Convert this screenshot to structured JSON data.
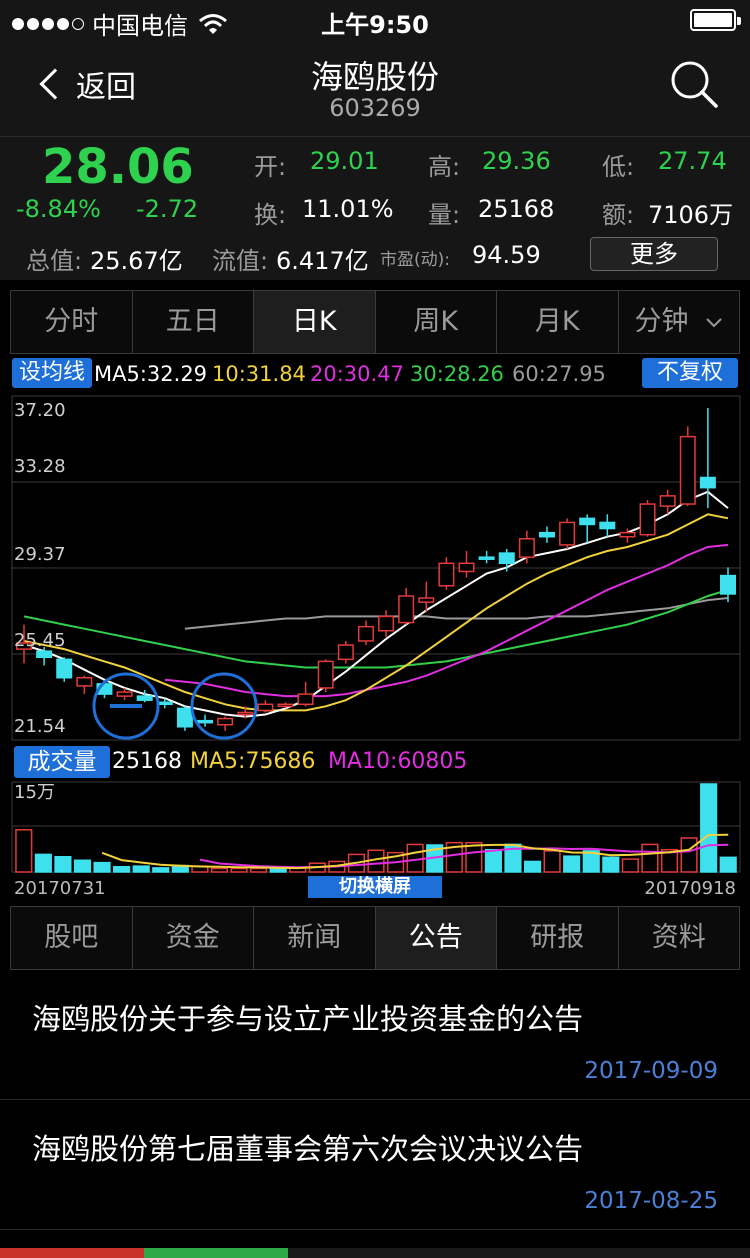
{
  "status_bar": {
    "carrier": "中国电信",
    "time": "上午9:50",
    "signal_bars": 4
  },
  "nav": {
    "back_label": "返回",
    "title": "海鸥股份",
    "code": "603269"
  },
  "quote": {
    "price": "28.06",
    "change_pct": "-8.84%",
    "change": "-2.72",
    "open_label": "开:",
    "open": "29.01",
    "high_label": "高:",
    "high": "29.36",
    "low_label": "低:",
    "low": "27.74",
    "turnover_label": "换:",
    "turnover": "11.01%",
    "volume_label": "量:",
    "volume": "25168",
    "amount_label": "额:",
    "amount": "7106万",
    "total_cap_label": "总值:",
    "total_cap": "25.67亿",
    "float_cap_label": "流值:",
    "float_cap": "6.417亿",
    "pe_label": "市盈(动):",
    "pe": "94.59",
    "more_label": "更多"
  },
  "chart_tabs": [
    {
      "label": "分时"
    },
    {
      "label": "五日"
    },
    {
      "label": "日K"
    },
    {
      "label": "周K"
    },
    {
      "label": "月K"
    },
    {
      "label": "分钟"
    }
  ],
  "active_chart_tab": "日K",
  "ma_bar": {
    "set_ma_label": "设均线",
    "ma5": "MA5:32.29",
    "ma10": "10:31.84",
    "ma20": "20:30.47",
    "ma30": "30:28.26",
    "ma60": "60:27.95",
    "adjust_label": "不复权"
  },
  "volume_bar": {
    "label": "成交量",
    "value": "25168",
    "ma5": "MA5:75686",
    "ma10": "MA10:60805",
    "scale_label": "15万"
  },
  "dates": {
    "start": "20170731",
    "end": "20170918",
    "switch_label": "切换横屏"
  },
  "colors": {
    "up": "#e33b3b",
    "down": "#3fe0ee",
    "ma5": "#ffffff",
    "ma10": "#f2d23c",
    "ma20": "#e02ee0",
    "ma30": "#32d04a",
    "ma60": "#9a9a9a",
    "accent_blue": "#1e6fd8",
    "green_price": "#2fd24f"
  },
  "chart_data": {
    "type": "candlestick",
    "y_axis_labels": [
      "37.20",
      "33.28",
      "29.37",
      "25.45",
      "21.54"
    ],
    "ylim": [
      21.54,
      37.2
    ],
    "candles": [
      {
        "o": 25.4,
        "c": 25.7,
        "h": 26.6,
        "l": 24.7
      },
      {
        "o": 25.3,
        "c": 25.0,
        "h": 25.5,
        "l": 24.6
      },
      {
        "o": 24.9,
        "c": 24.0,
        "h": 25.0,
        "l": 23.8
      },
      {
        "o": 23.6,
        "c": 24.0,
        "h": 24.1,
        "l": 23.2
      },
      {
        "o": 23.7,
        "c": 23.2,
        "h": 23.9,
        "l": 23.0
      },
      {
        "o": 23.1,
        "c": 23.3,
        "h": 23.5,
        "l": 22.9
      },
      {
        "o": 23.1,
        "c": 22.9,
        "h": 23.4,
        "l": 22.8
      },
      {
        "o": 22.8,
        "c": 22.7,
        "h": 23.0,
        "l": 22.5
      },
      {
        "o": 22.5,
        "c": 21.6,
        "h": 22.6,
        "l": 21.4
      },
      {
        "o": 21.9,
        "c": 21.8,
        "h": 22.2,
        "l": 21.6
      },
      {
        "o": 21.7,
        "c": 22.0,
        "h": 22.1,
        "l": 21.4
      },
      {
        "o": 22.3,
        "c": 22.3,
        "h": 22.6,
        "l": 22.0
      },
      {
        "o": 22.4,
        "c": 22.7,
        "h": 22.9,
        "l": 22.3
      },
      {
        "o": 22.6,
        "c": 22.7,
        "h": 22.8,
        "l": 22.5
      },
      {
        "o": 22.7,
        "c": 23.2,
        "h": 23.8,
        "l": 22.6
      },
      {
        "o": 23.5,
        "c": 24.8,
        "h": 24.9,
        "l": 23.3
      },
      {
        "o": 24.9,
        "c": 25.6,
        "h": 25.8,
        "l": 24.7
      },
      {
        "o": 25.8,
        "c": 26.5,
        "h": 26.8,
        "l": 25.6
      },
      {
        "o": 26.3,
        "c": 27.0,
        "h": 27.3,
        "l": 26.0
      },
      {
        "o": 26.7,
        "c": 28.0,
        "h": 28.4,
        "l": 26.6
      },
      {
        "o": 27.7,
        "c": 27.9,
        "h": 28.7,
        "l": 27.2
      },
      {
        "o": 28.5,
        "c": 29.6,
        "h": 29.9,
        "l": 28.3
      },
      {
        "o": 29.2,
        "c": 29.6,
        "h": 30.2,
        "l": 28.9
      },
      {
        "o": 29.9,
        "c": 29.8,
        "h": 30.2,
        "l": 29.6
      },
      {
        "o": 30.1,
        "c": 29.6,
        "h": 30.3,
        "l": 29.2
      },
      {
        "o": 29.9,
        "c": 30.8,
        "h": 31.2,
        "l": 29.6
      },
      {
        "o": 31.1,
        "c": 30.9,
        "h": 31.4,
        "l": 30.6
      },
      {
        "o": 30.5,
        "c": 31.6,
        "h": 31.8,
        "l": 30.3
      },
      {
        "o": 31.8,
        "c": 31.5,
        "h": 32.0,
        "l": 30.6
      },
      {
        "o": 31.6,
        "c": 31.3,
        "h": 32.0,
        "l": 30.9
      },
      {
        "o": 30.9,
        "c": 31.1,
        "h": 31.3,
        "l": 30.6
      },
      {
        "o": 31.0,
        "c": 32.5,
        "h": 32.7,
        "l": 30.9
      },
      {
        "o": 32.4,
        "c": 32.9,
        "h": 33.2,
        "l": 32.0
      },
      {
        "o": 32.5,
        "c": 35.8,
        "h": 36.3,
        "l": 32.4
      },
      {
        "o": 33.8,
        "c": 33.3,
        "h": 37.2,
        "l": 32.3
      },
      {
        "o": 29.0,
        "c": 28.1,
        "h": 29.4,
        "l": 27.7
      }
    ],
    "volume_ylim": [
      0,
      150000
    ],
    "volumes": [
      72000,
      30000,
      26000,
      20000,
      16000,
      9000,
      10000,
      7000,
      11000,
      10000,
      6000,
      6000,
      6000,
      7000,
      8000,
      15000,
      18000,
      30000,
      37000,
      33000,
      47000,
      46000,
      50000,
      50000,
      38000,
      47000,
      18000,
      36000,
      27000,
      36000,
      25000,
      22000,
      47000,
      38000,
      58000,
      150000,
      25000
    ],
    "volume_dir": [
      "up",
      "down",
      "down",
      "down",
      "down",
      "down",
      "down",
      "down",
      "down",
      "up",
      "up",
      "up",
      "up",
      "down",
      "up",
      "up",
      "up",
      "up",
      "up",
      "up",
      "up",
      "down",
      "up",
      "up",
      "down",
      "down",
      "down",
      "up",
      "down",
      "down",
      "down",
      "up",
      "up",
      "up",
      "up",
      "down",
      "down"
    ],
    "ma5": [
      25.6,
      25.3,
      24.9,
      24.4,
      23.9,
      23.5,
      23.2,
      23.0,
      22.6,
      22.4,
      22.2,
      22.1,
      22.2,
      22.5,
      22.9,
      23.6,
      24.3,
      25.1,
      25.9,
      26.6,
      27.3,
      27.9,
      28.5,
      29.1,
      29.4,
      29.9,
      30.1,
      30.3,
      30.6,
      30.9,
      31.1,
      31.5,
      32.0,
      32.7,
      33.1,
      32.3
    ],
    "ma10": [
      25.8,
      25.6,
      25.4,
      25.1,
      24.8,
      24.5,
      24.1,
      23.7,
      23.3,
      23.0,
      22.7,
      22.5,
      22.4,
      22.4,
      22.4,
      22.6,
      22.9,
      23.4,
      24.0,
      24.6,
      25.3,
      26.0,
      26.7,
      27.4,
      28.0,
      28.6,
      29.1,
      29.5,
      29.9,
      30.2,
      30.4,
      30.7,
      31.0,
      31.5,
      32.0,
      31.8
    ],
    "ma20": [
      null,
      null,
      null,
      null,
      null,
      null,
      null,
      23.9,
      23.8,
      23.7,
      23.5,
      23.3,
      23.2,
      23.1,
      23.1,
      23.1,
      23.2,
      23.4,
      23.6,
      23.8,
      24.1,
      24.5,
      24.9,
      25.3,
      25.8,
      26.3,
      26.8,
      27.3,
      27.8,
      28.3,
      28.7,
      29.1,
      29.5,
      30.0,
      30.4,
      30.5
    ],
    "ma30": [
      27.0,
      26.8,
      26.6,
      26.4,
      26.2,
      26.0,
      25.8,
      25.6,
      25.4,
      25.2,
      25.0,
      24.8,
      24.7,
      24.6,
      24.5,
      24.5,
      24.5,
      24.5,
      24.5,
      24.6,
      24.7,
      24.8,
      25.0,
      25.2,
      25.4,
      25.6,
      25.8,
      26.0,
      26.2,
      26.4,
      26.6,
      26.9,
      27.2,
      27.6,
      28.0,
      28.3
    ],
    "ma60": [
      null,
      null,
      null,
      null,
      null,
      null,
      null,
      null,
      26.4,
      26.5,
      26.6,
      26.7,
      26.8,
      26.9,
      26.9,
      27.0,
      27.0,
      27.0,
      27.0,
      27.0,
      27.0,
      26.9,
      26.9,
      26.9,
      26.9,
      26.9,
      27.0,
      27.0,
      27.0,
      27.1,
      27.2,
      27.3,
      27.4,
      27.6,
      27.8,
      27.9
    ]
  },
  "news_tabs": [
    {
      "label": "股吧"
    },
    {
      "label": "资金"
    },
    {
      "label": "新闻"
    },
    {
      "label": "公告"
    },
    {
      "label": "研报"
    },
    {
      "label": "资料"
    }
  ],
  "active_news_tab": "公告",
  "announcements": [
    {
      "title": "海鸥股份关于参与设立产业投资基金的公告",
      "date": "2017-09-09"
    },
    {
      "title": "海鸥股份第七届董事会第六次会议决议公告",
      "date": "2017-08-25"
    }
  ]
}
